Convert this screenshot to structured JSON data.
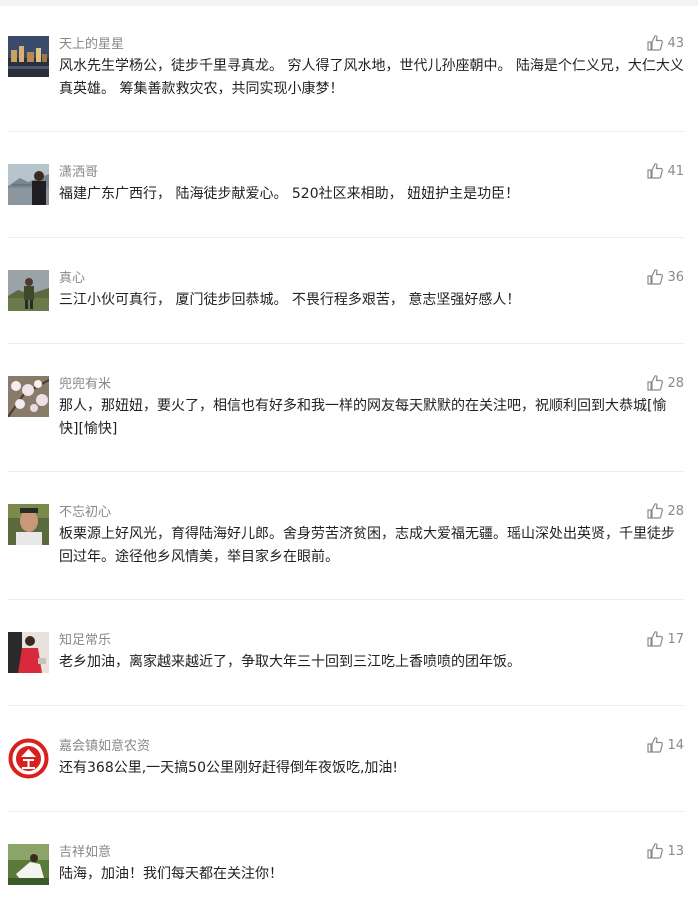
{
  "comments": [
    {
      "user": "天上的星星",
      "likes": "43",
      "avatar": "city-night-photo-icon",
      "text": "风水先生学杨公，徒步千里寻真龙。 穷人得了风水地，世代儿孙座朝中。 陆海是个仁义兄，大仁大义真英雄。 筹集善款救灾农，共同实现小康梦！"
    },
    {
      "user": "潇洒哥",
      "likes": "41",
      "avatar": "man-with-bridge-photo-icon",
      "text": "福建广东广西行， 陆海徒步献爱心。 520社区来相助， 妞妞护主是功臣！"
    },
    {
      "user": "真心",
      "likes": "36",
      "avatar": "person-outdoors-photo-icon",
      "text": "三江小伙可真行， 厦门徒步回恭城。 不畏行程多艰苦， 意志坚强好感人！"
    },
    {
      "user": "兜兜有米",
      "likes": "28",
      "avatar": "blossom-branch-photo-icon",
      "text": "那人，那妞妞，要火了，相信也有好多和我一样的网友每天默默的在关注吧，祝顺利回到大恭城[愉快][愉快]"
    },
    {
      "user": "不忘初心",
      "likes": "28",
      "avatar": "man-portrait-photo-icon",
      "text": "板栗源上好风光，育得陆海好儿郎。舍身劳苦济贫困，志成大爱福无疆。瑶山深处出英贤，千里徒步回过年。途径他乡风情美，举目家乡在眼前。"
    },
    {
      "user": "知足常乐",
      "likes": "17",
      "avatar": "woman-red-dress-photo-icon",
      "text": "老乡加油，离家越来越近了，争取大年三十回到三江吃上香喷喷的团年饭。"
    },
    {
      "user": "嘉会镇如意农资",
      "likes": "14",
      "avatar": "red-round-logo-icon",
      "text": "还有368公里,一天搞50公里刚好赶得倒年夜饭吃,加油!"
    },
    {
      "user": "吉祥如意",
      "likes": "13",
      "avatar": "person-in-nature-photo-icon",
      "text": "陆海，加油！我们每天都在关注你！"
    }
  ],
  "colors": {
    "username": "#888888",
    "text": "#222222",
    "divider": "#ececec",
    "like": "#8a8a8a"
  }
}
